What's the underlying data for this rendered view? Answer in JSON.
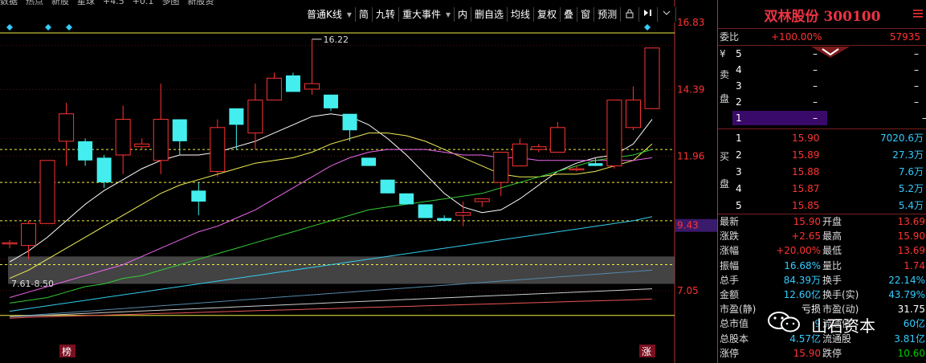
{
  "top_strip": [
    "数据",
    "热点",
    "新股",
    "星球",
    "+4.5",
    "+0.1",
    "多图",
    "新股资"
  ],
  "toolbar": [
    {
      "label": "普通K线",
      "dropdown": true
    },
    {
      "label": "简",
      "dropdown": false
    },
    {
      "label": "九转",
      "dropdown": false
    },
    {
      "label": "重大事件",
      "dropdown": true
    },
    {
      "label": "内",
      "dropdown": false
    },
    {
      "label": "删自选",
      "dropdown": false
    },
    {
      "label": "均线",
      "dropdown": false
    },
    {
      "label": "复权",
      "dropdown": false
    },
    {
      "label": "叠",
      "dropdown": false
    },
    {
      "label": "窗",
      "dropdown": false
    },
    {
      "label": "预测",
      "dropdown": false
    }
  ],
  "toolbar_icons": [
    "lock-icon",
    "play-pause-icon",
    "expand-icon"
  ],
  "chart": {
    "price_axis": [
      {
        "v": "16.83",
        "p": 16.83
      },
      {
        "v": "14.39",
        "p": 14.39
      },
      {
        "v": "11.96",
        "p": 11.96
      },
      {
        "v": "9.43",
        "p": 9.43,
        "highlight": true
      },
      {
        "v": "7.05",
        "p": 7.05
      }
    ],
    "annotations": {
      "high": "16.22",
      "low": "7.61-8.50"
    },
    "bottom_marks": {
      "left": "榜",
      "right": "涨"
    },
    "candles": [
      [
        8.8,
        8.8,
        8.6,
        8.9
      ],
      [
        8.7,
        9.5,
        8.2,
        9.6
      ],
      [
        9.5,
        11.8,
        9.5,
        11.8
      ],
      [
        12.5,
        13.5,
        11.6,
        13.9
      ],
      [
        12.5,
        11.8,
        11.6,
        12.6
      ],
      [
        11.9,
        11.0,
        10.8,
        12.0
      ],
      [
        12.0,
        13.3,
        11.3,
        13.8
      ],
      [
        12.3,
        12.4,
        12.2,
        12.6
      ],
      [
        11.8,
        13.3,
        11.3,
        14.6
      ],
      [
        13.3,
        12.5,
        12.0,
        13.3
      ],
      [
        10.7,
        10.3,
        9.8,
        11.0
      ],
      [
        11.4,
        13.0,
        11.2,
        13.3
      ],
      [
        13.7,
        13.1,
        12.2,
        13.7
      ],
      [
        12.8,
        14.0,
        12.2,
        14.6
      ],
      [
        14.0,
        14.8,
        14.0,
        15.0
      ],
      [
        14.9,
        14.3,
        14.3,
        15.0
      ],
      [
        14.4,
        14.6,
        14.2,
        16.22
      ],
      [
        14.2,
        13.7,
        13.6,
        14.2
      ],
      [
        13.5,
        12.9,
        12.5,
        13.5
      ],
      [
        11.9,
        11.6,
        11.6,
        11.9
      ],
      [
        11.1,
        10.6,
        10.6,
        11.1
      ],
      [
        10.6,
        10.2,
        10.2,
        10.6
      ],
      [
        10.2,
        9.7,
        9.7,
        10.2
      ],
      [
        9.7,
        9.6,
        9.6,
        9.8
      ],
      [
        9.8,
        9.9,
        9.4,
        10.3
      ],
      [
        10.3,
        10.4,
        10.1,
        10.4
      ],
      [
        11.0,
        12.1,
        10.5,
        12.1
      ],
      [
        11.6,
        12.4,
        11.6,
        12.6
      ],
      [
        12.2,
        12.3,
        12.1,
        12.4
      ],
      [
        12.1,
        13.0,
        12.1,
        13.2
      ],
      [
        11.5,
        11.5,
        11.4,
        11.6
      ],
      [
        11.7,
        11.6,
        11.6,
        11.9
      ],
      [
        11.6,
        14.0,
        11.5,
        14.0
      ],
      [
        13.0,
        14.0,
        12.9,
        14.5
      ],
      [
        13.69,
        15.9,
        13.69,
        15.9
      ]
    ],
    "ma_lines": [
      {
        "color": "#ffffff",
        "values": [
          8.1,
          8.5,
          9.0,
          9.6,
          10.2,
          10.7,
          11.1,
          11.5,
          11.8,
          12.0,
          12.0,
          12.1,
          12.3,
          12.5,
          12.8,
          13.1,
          13.4,
          13.5,
          13.4,
          13.1,
          12.6,
          12.0,
          11.3,
          10.6,
          10.1,
          9.9,
          10.0,
          10.4,
          10.9,
          11.4,
          11.7,
          11.9,
          12.0,
          12.4,
          13.3
        ]
      },
      {
        "color": "#eeee55",
        "values": [
          7.5,
          7.8,
          8.2,
          8.6,
          9.0,
          9.4,
          9.8,
          10.2,
          10.6,
          10.9,
          11.1,
          11.3,
          11.5,
          11.7,
          11.8,
          11.9,
          12.1,
          12.4,
          12.6,
          12.8,
          12.8,
          12.7,
          12.5,
          12.2,
          11.9,
          11.6,
          11.3,
          11.2,
          11.2,
          11.3,
          11.3,
          11.4,
          11.6,
          11.8,
          12.4
        ]
      },
      {
        "color": "#ee66ee",
        "values": [
          6.8,
          7.0,
          7.2,
          7.4,
          7.6,
          7.8,
          8.0,
          8.3,
          8.6,
          8.9,
          9.2,
          9.4,
          9.7,
          10.0,
          10.4,
          10.8,
          11.2,
          11.6,
          11.9,
          12.1,
          12.2,
          12.2,
          12.2,
          12.1,
          12.0,
          12.0,
          11.9,
          11.9,
          11.8,
          11.8,
          11.8,
          11.8,
          11.8,
          11.8,
          11.9
        ]
      },
      {
        "color": "#33cc33",
        "values": [
          6.6,
          6.7,
          6.8,
          7.0,
          7.2,
          7.3,
          7.5,
          7.6,
          7.8,
          8.0,
          8.2,
          8.4,
          8.6,
          8.8,
          9.0,
          9.2,
          9.4,
          9.6,
          9.8,
          10.0,
          10.1,
          10.2,
          10.3,
          10.4,
          10.5,
          10.6,
          10.8,
          11.0,
          11.2,
          11.4,
          11.6,
          11.8,
          11.9,
          12.0,
          12.2
        ]
      },
      {
        "color": "#33ccee",
        "values": [
          6.3,
          6.4,
          6.5,
          6.6,
          6.7,
          6.8,
          6.9,
          7.0,
          7.1,
          7.2,
          7.3,
          7.4,
          7.5,
          7.6,
          7.7,
          7.8,
          7.9,
          8.0,
          8.1,
          8.2,
          8.3,
          8.4,
          8.5,
          8.6,
          8.7,
          8.8,
          8.9,
          9.0,
          9.1,
          9.2,
          9.3,
          9.4,
          9.5,
          9.6,
          9.75
        ]
      },
      {
        "color": "#5588aa",
        "values": [
          6.1,
          6.15,
          6.2,
          6.25,
          6.3,
          6.35,
          6.4,
          6.45,
          6.5,
          6.55,
          6.6,
          6.65,
          6.7,
          6.75,
          6.8,
          6.85,
          6.9,
          6.95,
          7.0,
          7.05,
          7.1,
          7.15,
          7.2,
          7.25,
          7.3,
          7.35,
          7.4,
          7.45,
          7.5,
          7.55,
          7.6,
          7.65,
          7.7,
          7.75,
          7.8
        ]
      },
      {
        "color": "#cccccc",
        "values": [
          6.1,
          6.13,
          6.16,
          6.19,
          6.22,
          6.25,
          6.28,
          6.31,
          6.34,
          6.37,
          6.4,
          6.43,
          6.46,
          6.49,
          6.52,
          6.55,
          6.58,
          6.61,
          6.64,
          6.67,
          6.7,
          6.73,
          6.76,
          6.79,
          6.82,
          6.85,
          6.88,
          6.91,
          6.94,
          6.97,
          7.0,
          7.03,
          7.06,
          7.09,
          7.12
        ]
      },
      {
        "color": "#ee5555",
        "values": [
          6.05,
          6.08,
          6.1,
          6.12,
          6.14,
          6.16,
          6.18,
          6.2,
          6.22,
          6.24,
          6.26,
          6.28,
          6.3,
          6.32,
          6.34,
          6.36,
          6.38,
          6.4,
          6.42,
          6.44,
          6.46,
          6.48,
          6.5,
          6.52,
          6.54,
          6.56,
          6.58,
          6.6,
          6.62,
          6.64,
          6.66,
          6.68,
          6.7,
          6.72,
          6.75
        ]
      }
    ],
    "dashed_levels": [
      12.2,
      11.0,
      9.6,
      8.0
    ],
    "top_line": 16.45,
    "bottom_line": 6.15
  },
  "panel": {
    "stock_name": "双林股份 300100",
    "webi": {
      "label": "委比",
      "pct": "+100.00%",
      "diff": "57935"
    },
    "sell_side_label": [
      "¥",
      "卖",
      "盘"
    ],
    "sells": [
      {
        "n": "5",
        "price": "–",
        "vol": "–"
      },
      {
        "n": "4",
        "price": "–",
        "vol": "–"
      },
      {
        "n": "3",
        "price": "–",
        "vol": "–"
      },
      {
        "n": "2",
        "price": "–",
        "vol": "–"
      },
      {
        "n": "1",
        "price": "–",
        "vol": "–"
      }
    ],
    "buy_side_label": [
      "买",
      "盘"
    ],
    "buys": [
      {
        "n": "1",
        "price": "15.90",
        "vol": "7020.6万"
      },
      {
        "n": "2",
        "price": "15.89",
        "vol": "27.3万"
      },
      {
        "n": "3",
        "price": "15.88",
        "vol": "7.6万"
      },
      {
        "n": "4",
        "price": "15.87",
        "vol": "5.2万"
      },
      {
        "n": "5",
        "price": "15.85",
        "vol": "5.4万"
      }
    ],
    "stats": [
      {
        "l1": "最新",
        "v1": "15.90",
        "c1": "red",
        "l2": "开盘",
        "v2": "13.69",
        "c2": "red"
      },
      {
        "l1": "涨跌",
        "v1": "+2.65",
        "c1": "red",
        "l2": "最高",
        "v2": "15.90",
        "c2": "red"
      },
      {
        "l1": "涨幅",
        "v1": "+20.00%",
        "c1": "red",
        "l2": "最低",
        "v2": "13.69",
        "c2": "red"
      },
      {
        "l1": "振幅",
        "v1": "16.68%",
        "c1": "cyan",
        "l2": "量比",
        "v2": "1.74",
        "c2": "red"
      },
      {
        "l1": "总手",
        "v1": "84.39万",
        "c1": "cyan",
        "l2": "换手",
        "v2": "22.14%",
        "c2": "cyan"
      },
      {
        "l1": "金额",
        "v1": "12.60亿",
        "c1": "cyan",
        "l2": "换手(实)",
        "v2": "43.79%",
        "c2": "cyan"
      },
      {
        "l1": "市盈(静)",
        "v1": "亏损",
        "c1": "white",
        "l2": "市盈(动)",
        "v2": "31.75",
        "c2": "white"
      },
      {
        "l1": "总市值",
        "v1": "9",
        "c1": "cyan",
        "l2": "流通值",
        "v2": "60亿",
        "c2": "cyan"
      },
      {
        "l1": "总股本",
        "v1": "4.57亿",
        "c1": "cyan",
        "l2": "流通股",
        "v2": "3.81亿",
        "c2": "cyan"
      },
      {
        "l1": "涨停",
        "v1": "15.90",
        "c1": "red",
        "l2": "跌停",
        "v2": "10.60",
        "c2": "green"
      }
    ],
    "watermark": "山石资本"
  }
}
